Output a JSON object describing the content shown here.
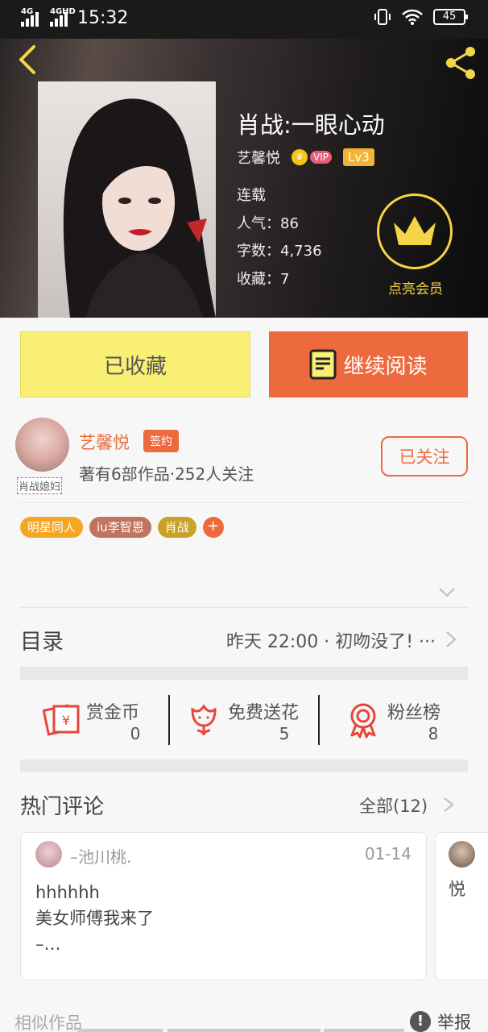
{
  "status_bar": {
    "network_left": "4G",
    "network_right": "4GHD",
    "time": "15:32",
    "battery": "45"
  },
  "book": {
    "title": "肖战:一眼心动",
    "author": "艺馨悦",
    "vip_label": "VIP",
    "level": "Lv3",
    "status": "连载",
    "popularity_label": "人气：",
    "popularity": "86",
    "words_label": "字数：",
    "words": "4,736",
    "favorites_label": "收藏：",
    "favorites": "7",
    "member_label": "点亮会员"
  },
  "actions": {
    "favorited_label": "已收藏",
    "continue_label": "继续阅读"
  },
  "author": {
    "name": "艺馨悦",
    "signed_label": "签约",
    "stats": "著有6部作品·252人关注",
    "avatar_caption": "肖战媳妇",
    "follow_label": "已关注"
  },
  "tags": [
    {
      "label": "明星同人",
      "color": "#f5a623"
    },
    {
      "label": "iu李智恩",
      "color": "#c0735f"
    },
    {
      "label": "肖战",
      "color": "#c9a227"
    }
  ],
  "tag_add": "+",
  "toc": {
    "title": "目录",
    "latest": "昨天 22:00 · 初吻没了! ···"
  },
  "stats": [
    {
      "label": "赏金币",
      "value": "0",
      "icon": "red-envelope-icon"
    },
    {
      "label": "免费送花",
      "value": "5",
      "icon": "flower-icon"
    },
    {
      "label": "粉丝榜",
      "value": "8",
      "icon": "medal-icon"
    }
  ],
  "comments_section": {
    "title": "热门评论",
    "all_label": "全部(12)"
  },
  "comments": [
    {
      "user": "–池川桃.",
      "date": "01-14",
      "lines": [
        "hhhhhh",
        "美女师傅我来了",
        "–…"
      ]
    },
    {
      "preview": "悦"
    }
  ],
  "footer": {
    "similar": "相似作品",
    "report": "举报"
  },
  "colors": {
    "accent": "#ec6a3d",
    "favorite_bg": "#f8ef74",
    "member_gold": "#f5d547"
  }
}
